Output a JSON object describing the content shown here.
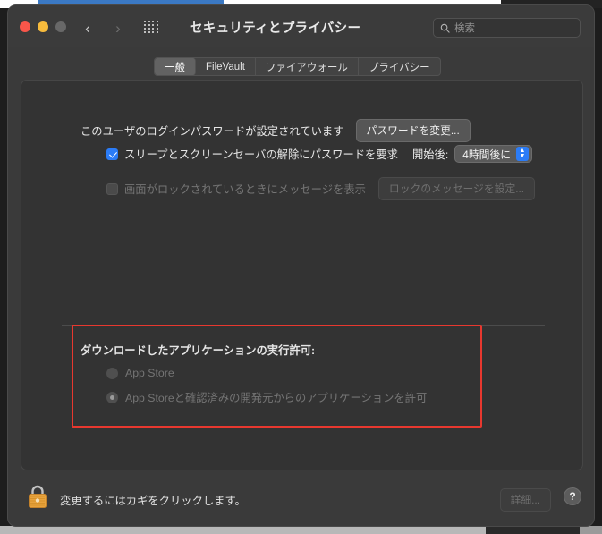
{
  "window": {
    "title": "セキュリティとプライバシー",
    "traffic_lights": [
      "close-red",
      "minimize-yellow",
      "zoom-disabled-gray"
    ],
    "nav": {
      "back": "‹",
      "forward": "›"
    },
    "grid_button": "all-preferences-grid"
  },
  "search": {
    "placeholder": "検索",
    "value": ""
  },
  "tabs": [
    {
      "label": "一般",
      "active": true
    },
    {
      "label": "FileVault",
      "active": false
    },
    {
      "label": "ファイアウォール",
      "active": false
    },
    {
      "label": "プライバシー",
      "active": false
    }
  ],
  "general": {
    "password_status": "このユーザのログインパスワードが設定されています",
    "change_password_button": "パスワードを変更...",
    "require_password": {
      "label": "スリープとスクリーンセーバの解除にパスワードを要求",
      "checked": true,
      "delay_label": "開始後:",
      "delay_value": "4時間後に"
    },
    "show_message": {
      "label": "画面がロックされているときにメッセージを表示",
      "checked": false,
      "enabled": false,
      "set_message_button": "ロックのメッセージを設定..."
    }
  },
  "download_permissions": {
    "heading": "ダウンロードしたアプリケーションの実行許可:",
    "options": [
      {
        "label": "App Store",
        "selected": false
      },
      {
        "label": "App Storeと確認済みの開発元からのアプリケーションを許可",
        "selected": true
      }
    ],
    "enabled": false,
    "highlight_color": "#e8382f"
  },
  "bottom": {
    "lock_state": "locked",
    "lock_text": "変更するにはカギをクリックします。",
    "advanced_button": "詳細...",
    "advanced_enabled": false,
    "help_button": "?"
  },
  "colors": {
    "accent_blue": "#2b7cf7",
    "window_bg": "#3a3a3a",
    "panel_bg": "#333333",
    "annotation_red": "#e8382f",
    "lock_gold": "#e8a33d"
  }
}
